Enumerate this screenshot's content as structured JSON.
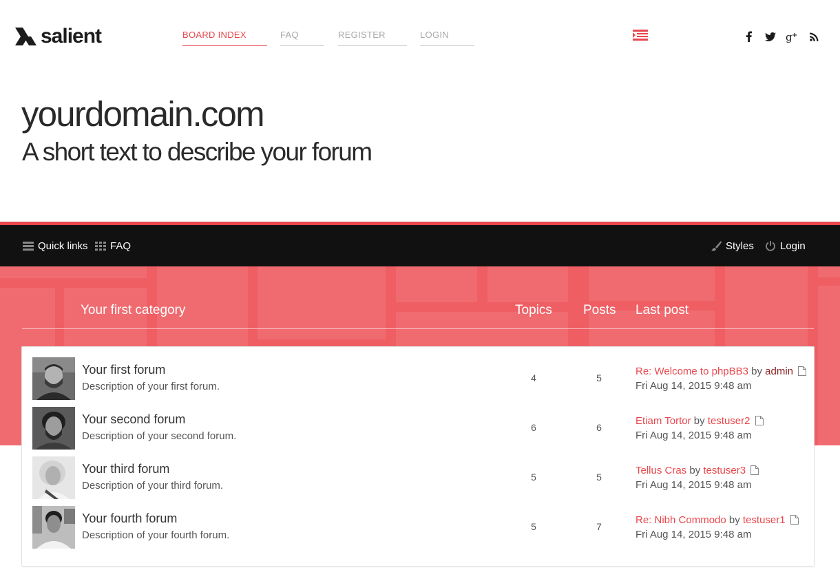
{
  "header": {
    "logo_text": "salient",
    "nav": [
      {
        "label": "BOARD INDEX"
      },
      {
        "label": "FAQ"
      },
      {
        "label": "REGISTER"
      },
      {
        "label": "LOGIN"
      }
    ],
    "social_icons": [
      "facebook-icon",
      "twitter-icon",
      "google-plus-icon",
      "rss-icon"
    ]
  },
  "site": {
    "title": "yourdomain.com",
    "description": "A short text to describe your forum"
  },
  "navbar": {
    "quick_links": "Quick links",
    "faq": "FAQ",
    "styles": "Styles",
    "login": "Login"
  },
  "category": {
    "title": "Your first category",
    "col_topics": "Topics",
    "col_posts": "Posts",
    "col_last_post": "Last post"
  },
  "forums": [
    {
      "name": "Your first forum",
      "description": "Description of your first forum.",
      "topics": "4",
      "posts": "5",
      "last_post_title": "Re: Welcome to phpBB3",
      "by": "by",
      "last_post_user": "admin",
      "last_post_date": "Fri Aug 14, 2015 9:48 am"
    },
    {
      "name": "Your second forum",
      "description": "Description of your second forum.",
      "topics": "6",
      "posts": "6",
      "last_post_title": "Etiam Tortor",
      "by": "by",
      "last_post_user": "testuser2",
      "last_post_date": "Fri Aug 14, 2015 9:48 am"
    },
    {
      "name": "Your third forum",
      "description": "Description of your third forum.",
      "topics": "5",
      "posts": "5",
      "last_post_title": "Tellus Cras",
      "by": "by",
      "last_post_user": "testuser3",
      "last_post_date": "Fri Aug 14, 2015 9:48 am"
    },
    {
      "name": "Your fourth forum",
      "description": "Description of your fourth forum.",
      "topics": "5",
      "posts": "7",
      "last_post_title": "Re: Nibh Commodo",
      "by": "by",
      "last_post_user": "testuser1",
      "last_post_date": "Fri Aug 14, 2015 9:48 am"
    }
  ],
  "colors": {
    "accent": "#e8474c",
    "hero_red": "#ee5e63",
    "navbar": "#111111",
    "admin_user": "#8b1e1e"
  }
}
